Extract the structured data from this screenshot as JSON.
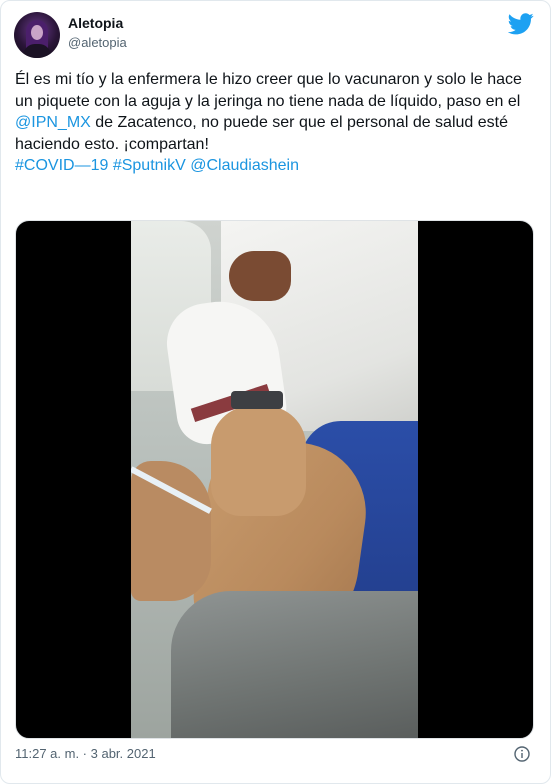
{
  "author": {
    "name": "Aletopia",
    "handle": "@aletopia"
  },
  "tweet": {
    "text_1": "Él es mi tío y la enfermera le hizo creer que lo vacunaron y solo le hace un piquete con la aguja y la jeringa no tiene nada de líquido, paso en el ",
    "mention_ipn": "@IPN_MX",
    "text_2": " de Zacatenco, no puede ser que el personal de salud esté haciendo esto. ¡compartan!",
    "hashtag_covid": "#COVID—19",
    "hashtag_sputnik": "#SputnikV",
    "mention_claudia": "@Claudiashein"
  },
  "meta": {
    "timestamp": "11:27 a. m. · 3 abr. 2021"
  },
  "icons": {
    "brand": "twitter-bird-icon",
    "info": "info-icon"
  },
  "colors": {
    "link": "#1b95e0",
    "brand": "#1da1f2",
    "text": "#0f1419",
    "secondary": "#536471"
  }
}
